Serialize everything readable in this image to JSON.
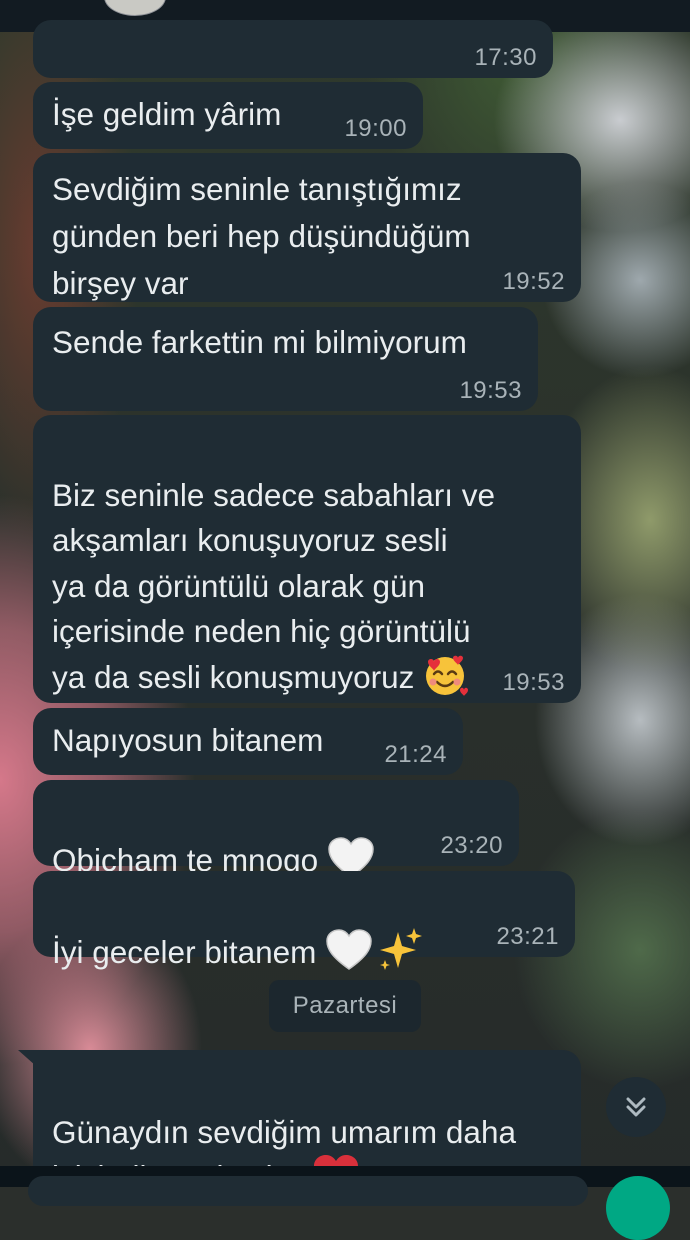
{
  "messages": [
    {
      "text": "",
      "time": "17:30"
    },
    {
      "text": "İşe geldim yârim",
      "time": "19:00"
    },
    {
      "text": "Sevdiğim seninle tanıştığımız\ngünden beri hep düşündüğüm\nbirşey var",
      "time": "19:52"
    },
    {
      "text": "Sende farkettin mi bilmiyorum",
      "time": "19:53"
    },
    {
      "text": "Biz seninle sadece sabahları ve\nakşamları konuşuyoruz sesli\nya da görüntülü olarak gün\niçerisinde neden hiç görüntülü\nya da sesli konuşmuyoruz",
      "time": "19:53",
      "emoji": "smiling-face-with-hearts"
    },
    {
      "text": "Napıyosun bitanem",
      "time": "21:24"
    },
    {
      "text": "Obicham te mnogo",
      "time": "23:20",
      "emoji": "white-heart"
    },
    {
      "text": "İyi geceler bitanem",
      "time": "23:21",
      "emoji": "white-heart sparkles"
    },
    {
      "text": "Günaydın sevdiğim umarım daha\niyisindir seni çok seviyorum",
      "time": "",
      "emoji": "red-heart"
    }
  ],
  "date_separator": "Pazartesi",
  "icons": {
    "scroll_down": "chevron-double-down-icon",
    "send": "send-icon"
  },
  "colors": {
    "bubble": "#1f2c34",
    "text": "#e9edef",
    "time": "#a9b3b8",
    "accent": "#00a884"
  }
}
